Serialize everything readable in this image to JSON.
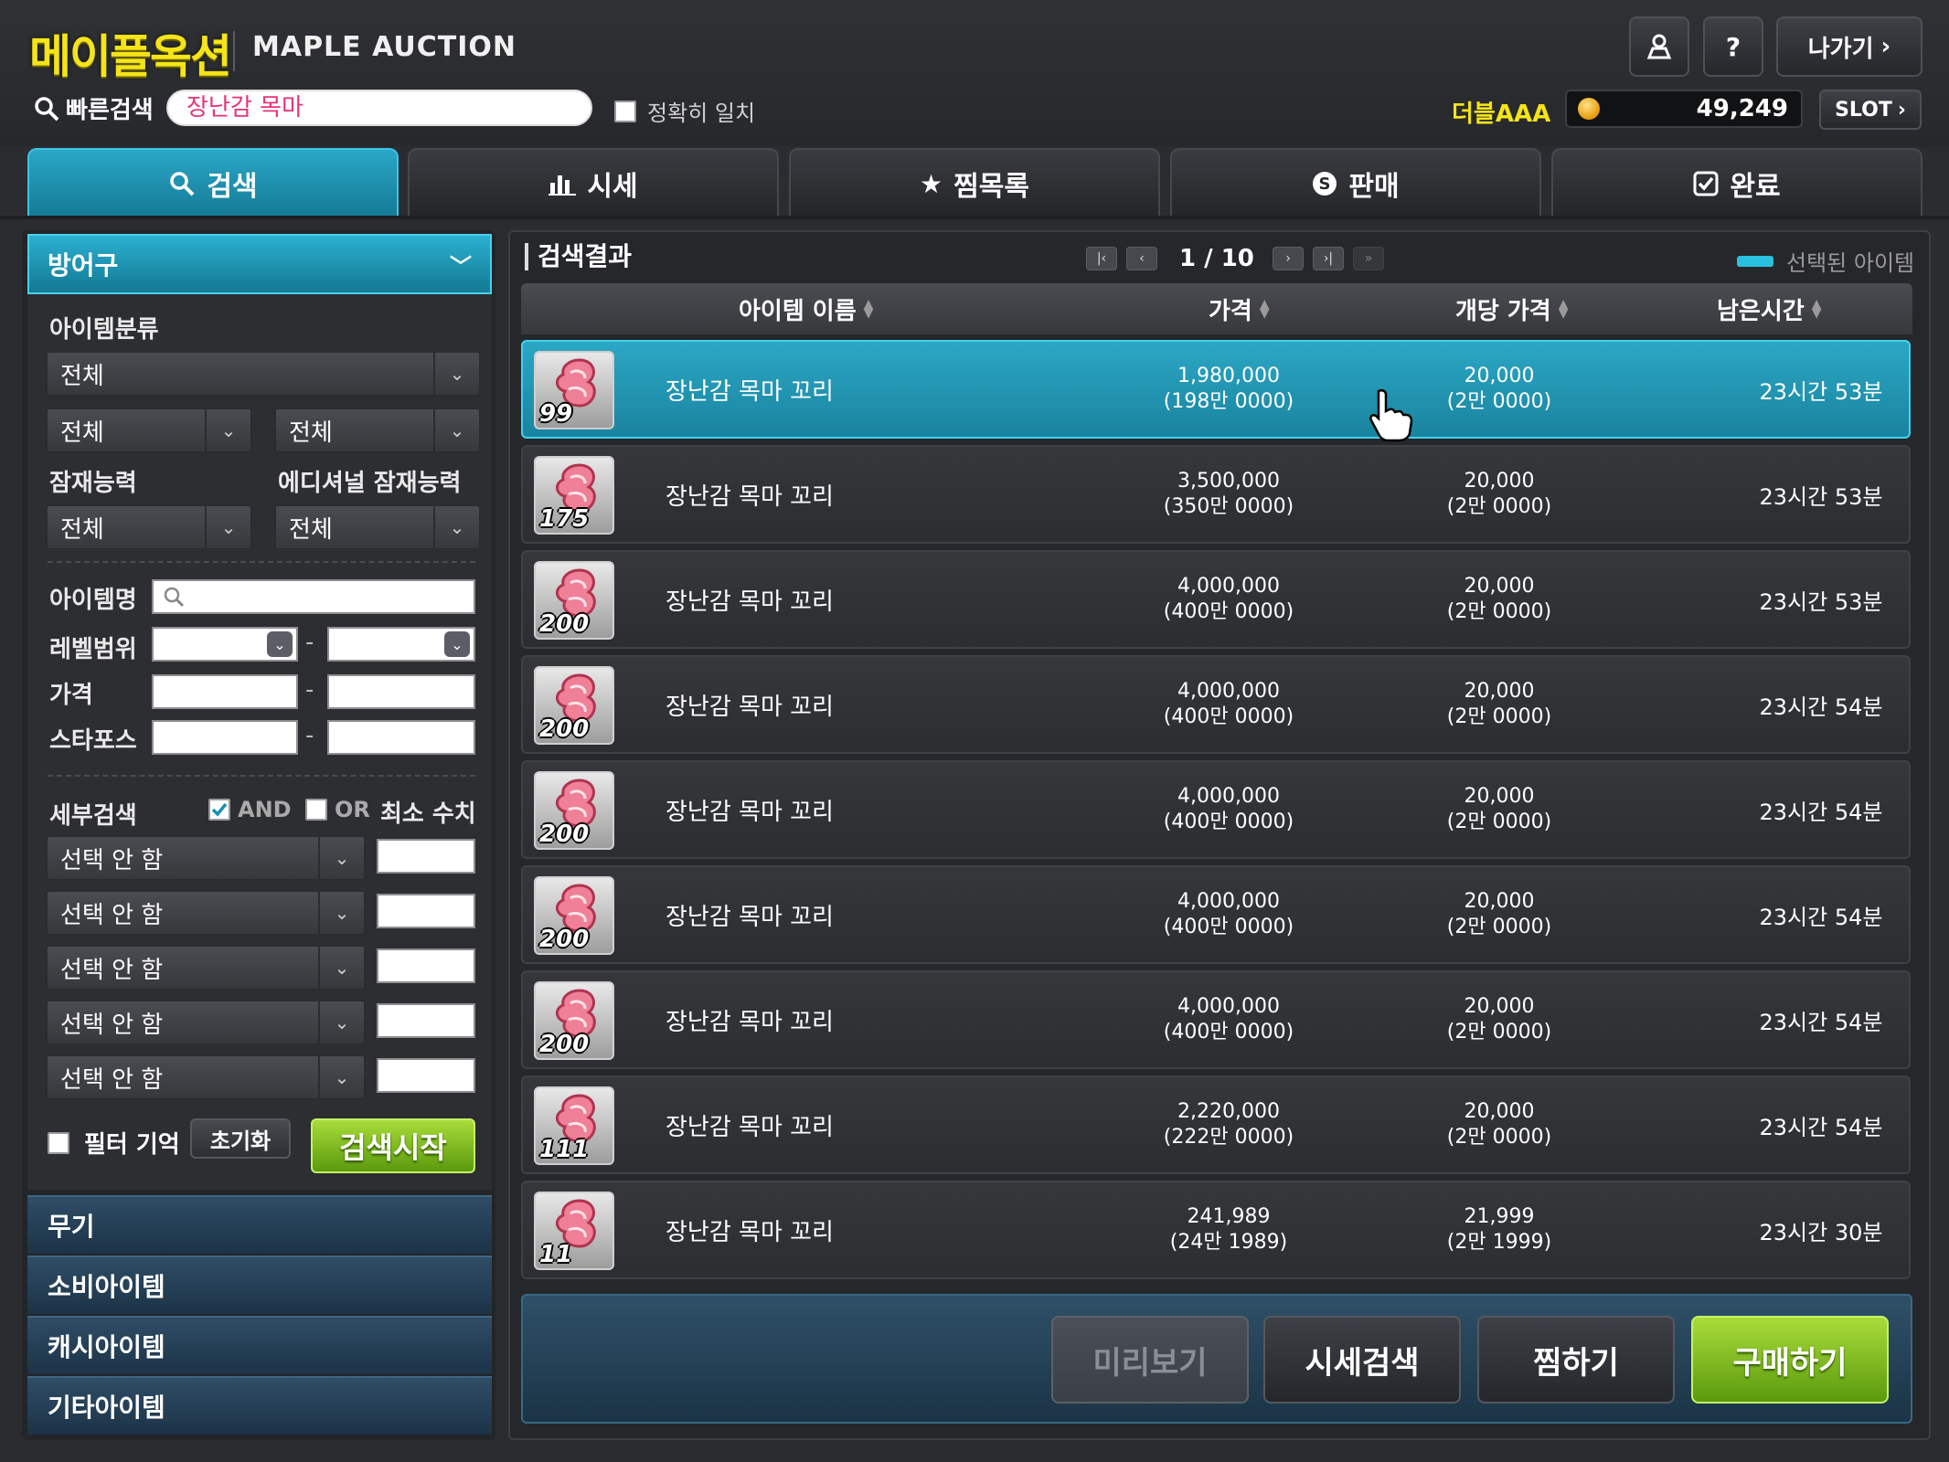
{
  "header": {
    "logo_ko": "메이플옥션",
    "logo_en": "MAPLE AUCTION",
    "quick_search_label": "빠른검색",
    "quick_search_value": "장난감 목마",
    "exact_match_label": "정확히 일치",
    "username": "더블AAA",
    "mesos": "49,249",
    "slot_label": "SLOT",
    "exit_label": "나가기",
    "help_label": "?"
  },
  "tabs": [
    {
      "label": "검색",
      "icon": "search-icon",
      "active": true
    },
    {
      "label": "시세",
      "icon": "bar-chart-icon"
    },
    {
      "label": "찜목록",
      "icon": "star-icon"
    },
    {
      "label": "판매",
      "icon": "coin-s-icon"
    },
    {
      "label": "완료",
      "icon": "check-box-icon"
    }
  ],
  "left": {
    "category_header": "방어구",
    "item_class_label": "아이템분류",
    "item_class_value": "전체",
    "sub1_value": "전체",
    "sub2_value": "전체",
    "potential_label": "잠재능력",
    "additional_potential_label": "에디셔널 잠재능력",
    "potential_value": "전체",
    "additional_potential_value": "전체",
    "item_name_label": "아이템명",
    "level_range_label": "레벨범위",
    "price_label": "가격",
    "starforce_label": "스타포스",
    "range_dash": "-",
    "detail_label": "세부검색",
    "and_label": "AND",
    "or_label": "OR",
    "min_value_label": "최소 수치",
    "detail_options": [
      "선택 안 함",
      "선택 안 함",
      "선택 안 함",
      "선택 안 함",
      "선택 안 함"
    ],
    "filter_memory_label": "필터 기억",
    "reset_label": "초기화",
    "search_start_label": "검색시작",
    "categories": [
      "무기",
      "소비아이템",
      "캐시아이템",
      "기타아이템"
    ]
  },
  "results": {
    "title": "검색결과",
    "page": "1 / 10",
    "selected_legend": "선택된 아이템",
    "columns": {
      "name": "아이템 이름",
      "price": "가격",
      "unit_price": "개당 가격",
      "time": "남은시간"
    },
    "rows": [
      {
        "qty": "99",
        "name": "장난감 목마 꼬리",
        "price": "1,980,000",
        "price_kr": "(198만 0000)",
        "unit": "20,000",
        "unit_kr": "(2만 0000)",
        "time": "23시간 53분",
        "selected": true
      },
      {
        "qty": "175",
        "name": "장난감 목마 꼬리",
        "price": "3,500,000",
        "price_kr": "(350만 0000)",
        "unit": "20,000",
        "unit_kr": "(2만 0000)",
        "time": "23시간 53분"
      },
      {
        "qty": "200",
        "name": "장난감 목마 꼬리",
        "price": "4,000,000",
        "price_kr": "(400만 0000)",
        "unit": "20,000",
        "unit_kr": "(2만 0000)",
        "time": "23시간 53분"
      },
      {
        "qty": "200",
        "name": "장난감 목마 꼬리",
        "price": "4,000,000",
        "price_kr": "(400만 0000)",
        "unit": "20,000",
        "unit_kr": "(2만 0000)",
        "time": "23시간 54분"
      },
      {
        "qty": "200",
        "name": "장난감 목마 꼬리",
        "price": "4,000,000",
        "price_kr": "(400만 0000)",
        "unit": "20,000",
        "unit_kr": "(2만 0000)",
        "time": "23시간 54분"
      },
      {
        "qty": "200",
        "name": "장난감 목마 꼬리",
        "price": "4,000,000",
        "price_kr": "(400만 0000)",
        "unit": "20,000",
        "unit_kr": "(2만 0000)",
        "time": "23시간 54분"
      },
      {
        "qty": "200",
        "name": "장난감 목마 꼬리",
        "price": "4,000,000",
        "price_kr": "(400만 0000)",
        "unit": "20,000",
        "unit_kr": "(2만 0000)",
        "time": "23시간 54분"
      },
      {
        "qty": "111",
        "name": "장난감 목마 꼬리",
        "price": "2,220,000",
        "price_kr": "(222만 0000)",
        "unit": "20,000",
        "unit_kr": "(2만 0000)",
        "time": "23시간 54분"
      },
      {
        "qty": "11",
        "name": "장난감 목마 꼬리",
        "price": "241,989",
        "price_kr": "(24만 1989)",
        "unit": "21,999",
        "unit_kr": "(2만 1999)",
        "time": "23시간 30분"
      }
    ]
  },
  "footer": {
    "preview_label": "미리보기",
    "price_search_label": "시세검색",
    "wishlist_label": "찜하기",
    "buy_label": "구매하기"
  },
  "colors": {
    "accent": "#1f9fbf",
    "logo_yellow": "#f4e418",
    "buy_green": "#7fbf1f",
    "quick_search_text": "#e4347a"
  }
}
